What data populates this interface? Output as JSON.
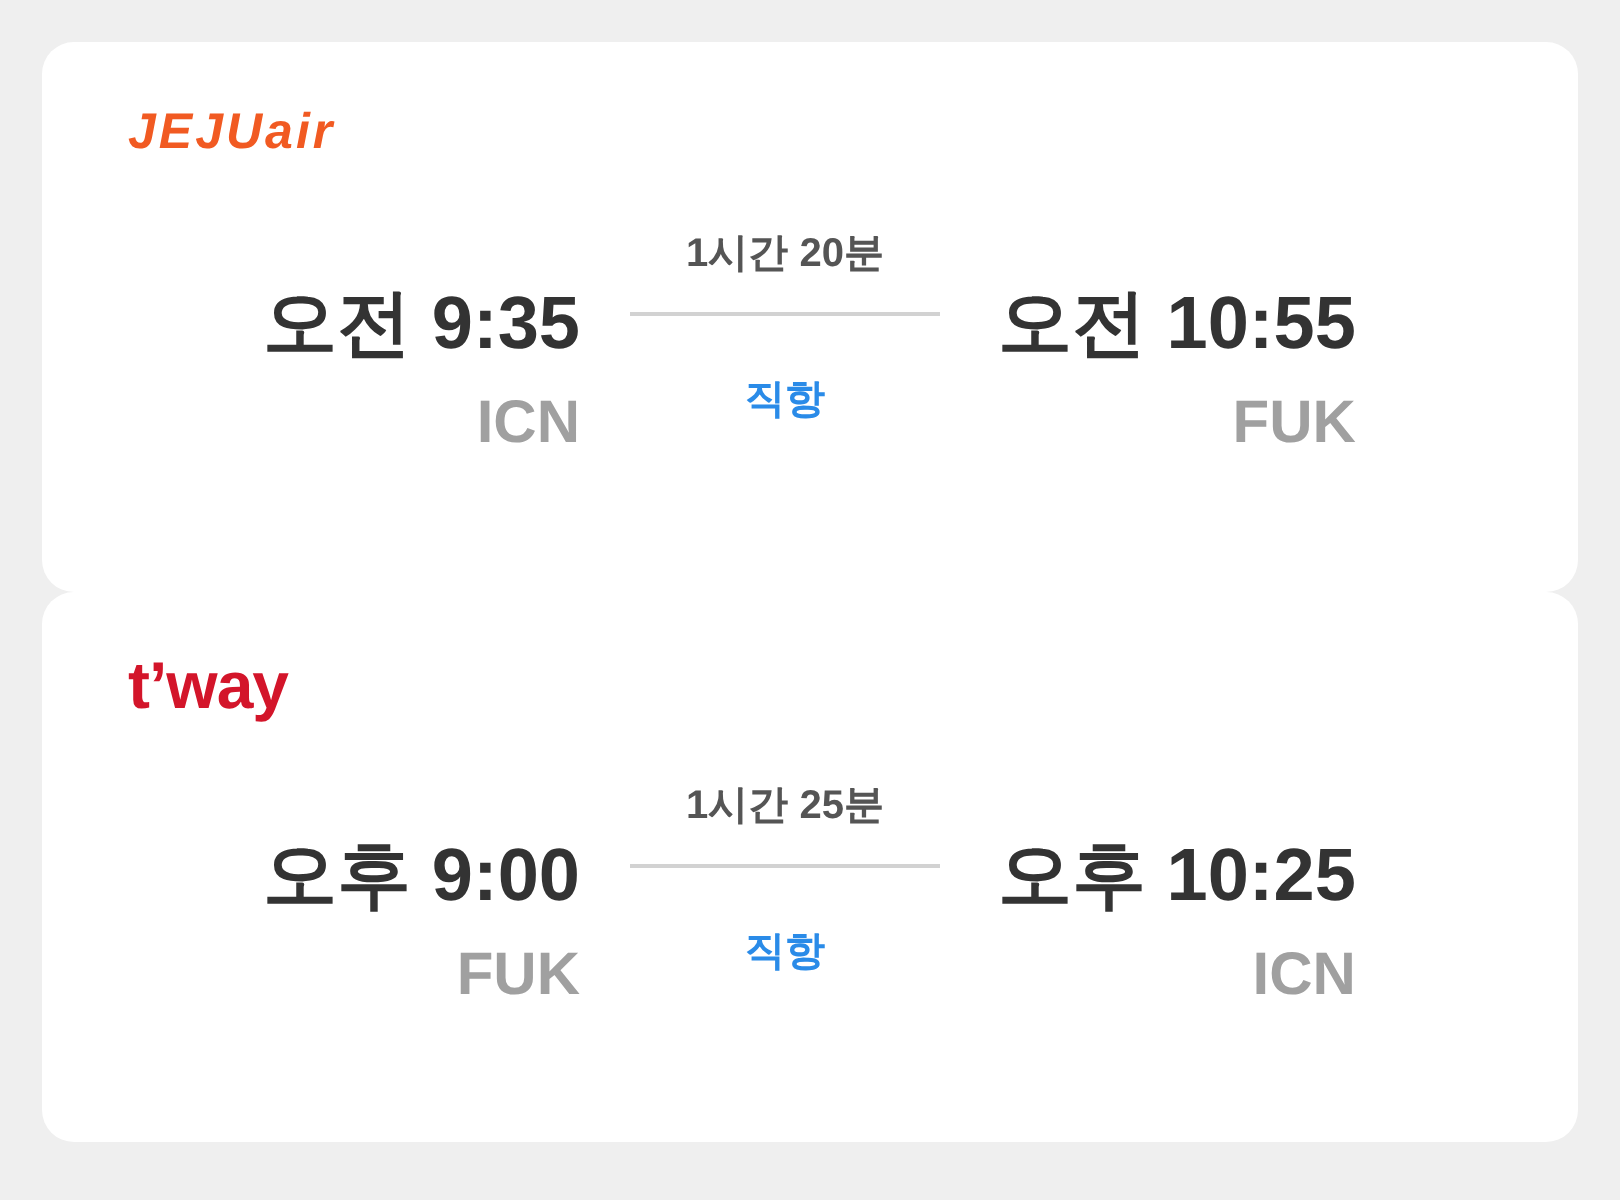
{
  "flights": [
    {
      "airline": {
        "kind": "jejuair",
        "name": "JEJUair"
      },
      "departure": {
        "time": "오전 9:35",
        "airport": "ICN"
      },
      "duration": "1시간 20분",
      "stops": "직항",
      "arrival": {
        "time": "오전 10:55",
        "airport": "FUK"
      }
    },
    {
      "airline": {
        "kind": "tway",
        "name": "t’way"
      },
      "departure": {
        "time": "오후 9:00",
        "airport": "FUK"
      },
      "duration": "1시간 25분",
      "stops": "직항",
      "arrival": {
        "time": "오후 10:25",
        "airport": "ICN"
      }
    }
  ]
}
